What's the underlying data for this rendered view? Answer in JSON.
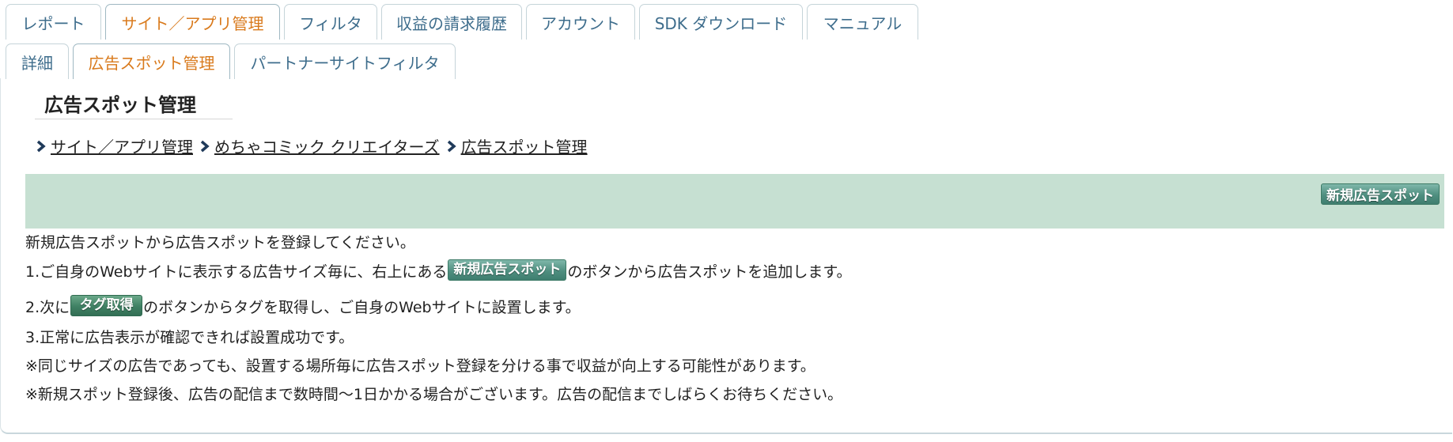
{
  "main_tabs": [
    {
      "label": "レポート",
      "active": false
    },
    {
      "label": "サイト／アプリ管理",
      "active": true
    },
    {
      "label": "フィルタ",
      "active": false
    },
    {
      "label": "収益の請求履歴",
      "active": false
    },
    {
      "label": "アカウント",
      "active": false
    },
    {
      "label": "SDK ダウンロード",
      "active": false
    },
    {
      "label": "マニュアル",
      "active": false
    }
  ],
  "sub_tabs": [
    {
      "label": "詳細",
      "active": false
    },
    {
      "label": "広告スポット管理",
      "active": true
    },
    {
      "label": "パートナーサイトフィルタ",
      "active": false
    }
  ],
  "page_title": "広告スポット管理",
  "breadcrumb": [
    {
      "label": "サイト／アプリ管理"
    },
    {
      "label": "めちゃコミック クリエイターズ"
    },
    {
      "label": "広告スポット管理"
    }
  ],
  "action_bar": {
    "new_spot_label": "新規広告スポット"
  },
  "instructions": {
    "line1": "新規広告スポットから広告スポットを登録してください。",
    "line2_pre": "1.ご自身のWebサイトに表示する広告サイズ毎に、右上にある",
    "line2_button": "新規広告スポット",
    "line2_post": "のボタンから広告スポットを追加します。",
    "line3_pre": "2.次に",
    "line3_button": "タグ取得",
    "line3_post": "のボタンからタグを取得し、ご自身のWebサイトに設置します。",
    "line4": "3.正常に広告表示が確認できれば設置成功です。",
    "line5": "※同じサイズの広告であっても、設置する場所毎に広告スポット登録を分ける事で収益が向上する可能性があります。",
    "line6": "※新規スポット登録後、広告の配信まで数時間〜1日かかる場合がございます。広告の配信までしばらくお待ちください。"
  },
  "colors": {
    "tab_text": "#3e6d8c",
    "tab_active_text": "#d97a1c",
    "action_bar_bg": "#c6e0d2",
    "breadcrumb_arrow": "#1f3a5a"
  }
}
